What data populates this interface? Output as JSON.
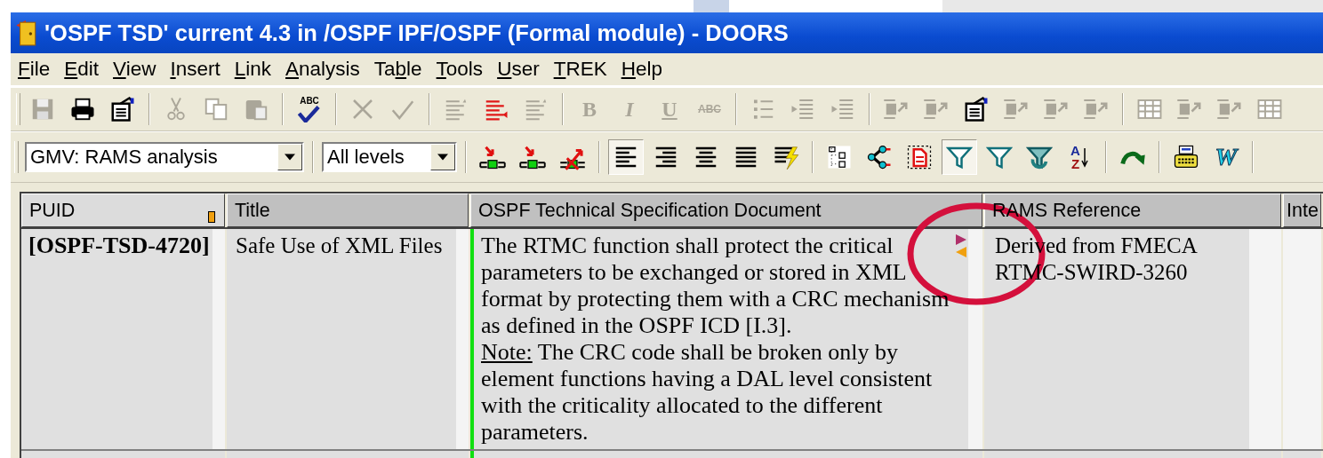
{
  "window": {
    "title": "'OSPF TSD' current 4.3 in /OSPF IPF/OSPF (Formal module) - DOORS"
  },
  "menu": [
    {
      "key": "F",
      "after": "ile"
    },
    {
      "key": "E",
      "after": "dit"
    },
    {
      "key": "V",
      "after": "iew"
    },
    {
      "key": "I",
      "after": "nsert"
    },
    {
      "key": "L",
      "after": "ink"
    },
    {
      "key": "A",
      "after": "nalysis"
    },
    {
      "before": "Ta",
      "key": "b",
      "after": "le"
    },
    {
      "key": "T",
      "after": "ools"
    },
    {
      "key": "U",
      "after": "ser"
    },
    {
      "key": "T",
      "after": "REK"
    },
    {
      "key": "H",
      "after": "elp"
    }
  ],
  "toolbar_1": [
    {
      "kind": "save",
      "disabled": true
    },
    {
      "kind": "print",
      "disabled": false
    },
    {
      "kind": "properties",
      "disabled": false
    },
    {
      "kind": "separator"
    },
    {
      "kind": "cut",
      "disabled": true
    },
    {
      "kind": "copy",
      "disabled": true
    },
    {
      "kind": "paste",
      "disabled": true
    },
    {
      "kind": "separator"
    },
    {
      "kind": "spell",
      "label": "ABC",
      "disabled": false
    },
    {
      "kind": "separator"
    },
    {
      "kind": "delete",
      "disabled": true
    },
    {
      "kind": "check",
      "disabled": true
    },
    {
      "kind": "separator"
    },
    {
      "kind": "lines",
      "disabled": true
    },
    {
      "kind": "lines-red",
      "disabled": false
    },
    {
      "kind": "lines",
      "disabled": true
    },
    {
      "kind": "separator"
    },
    {
      "kind": "bold",
      "label": "B",
      "disabled": true
    },
    {
      "kind": "italic",
      "label": "I",
      "disabled": true
    },
    {
      "kind": "underline",
      "label": "U",
      "disabled": true
    },
    {
      "kind": "strike",
      "label": "ABC",
      "disabled": true
    },
    {
      "kind": "separator"
    },
    {
      "kind": "bullets",
      "disabled": true
    },
    {
      "kind": "indent",
      "disabled": true
    },
    {
      "kind": "indent",
      "disabled": true
    },
    {
      "kind": "separator"
    },
    {
      "kind": "link",
      "disabled": true
    },
    {
      "kind": "link",
      "disabled": true
    },
    {
      "kind": "properties",
      "disabled": false
    },
    {
      "kind": "link",
      "disabled": true
    },
    {
      "kind": "link",
      "disabled": true
    },
    {
      "kind": "link",
      "disabled": true
    },
    {
      "kind": "separator"
    },
    {
      "kind": "table",
      "disabled": true
    },
    {
      "kind": "link",
      "disabled": true
    },
    {
      "kind": "link",
      "disabled": true
    },
    {
      "kind": "table",
      "disabled": true
    }
  ],
  "view_select": {
    "value": "GMV: RAMS analysis"
  },
  "level_select": {
    "value": "All levels"
  },
  "toolbar_2": [
    {
      "kind": "separator"
    },
    {
      "kind": "insert-object",
      "pressed": false
    },
    {
      "kind": "insert-object",
      "pressed": false
    },
    {
      "kind": "delete-object",
      "pressed": false
    },
    {
      "kind": "separator"
    },
    {
      "kind": "align-left",
      "pressed": true
    },
    {
      "kind": "align-right",
      "pressed": false
    },
    {
      "kind": "align-center",
      "pressed": false
    },
    {
      "kind": "align-justify",
      "pressed": false
    },
    {
      "kind": "lightning",
      "pressed": false
    },
    {
      "kind": "separator"
    },
    {
      "kind": "tree",
      "pressed": false
    },
    {
      "kind": "graph",
      "pressed": false
    },
    {
      "kind": "document",
      "pressed": false
    },
    {
      "kind": "filter",
      "pressed": true
    },
    {
      "kind": "filter",
      "pressed": false
    },
    {
      "kind": "filter-cycle",
      "pressed": false
    },
    {
      "kind": "sort",
      "top": "A",
      "bottom": "Z",
      "pressed": false
    },
    {
      "kind": "separator"
    },
    {
      "kind": "arrow",
      "pressed": false
    },
    {
      "kind": "separator"
    },
    {
      "kind": "typewriter",
      "pressed": false
    },
    {
      "kind": "word",
      "label": "W",
      "pressed": false
    },
    {
      "kind": "separator"
    }
  ],
  "table": {
    "columns": [
      {
        "label": "PUID",
        "marker": true
      },
      {
        "label": "Title",
        "marker": false
      },
      {
        "label": "OSPF Technical Specification Document",
        "marker": false
      },
      {
        "label": "RAMS Reference",
        "marker": false
      },
      {
        "label": "Inte",
        "marker": false
      }
    ],
    "rows": [
      {
        "puid": "[OSPF-TSD-4720]",
        "title": "Safe Use of XML Files",
        "changed": true,
        "out_link": true,
        "in_link": true,
        "paragraphs": [
          {
            "text": "The RTMC function shall protect the critical parameters to be exchanged or stored in XML format by protecting them with a CRC mechanism as defined in the OSPF ICD [I.3]."
          },
          {
            "lead": "Note:",
            "text": "The CRC code shall be broken only by element functions having a DAL level consistent with the criticality allocated to the different parameters."
          }
        ],
        "rams": [
          "Derived from FMECA",
          "RTMC-SWIRD-3260"
        ]
      }
    ]
  }
}
